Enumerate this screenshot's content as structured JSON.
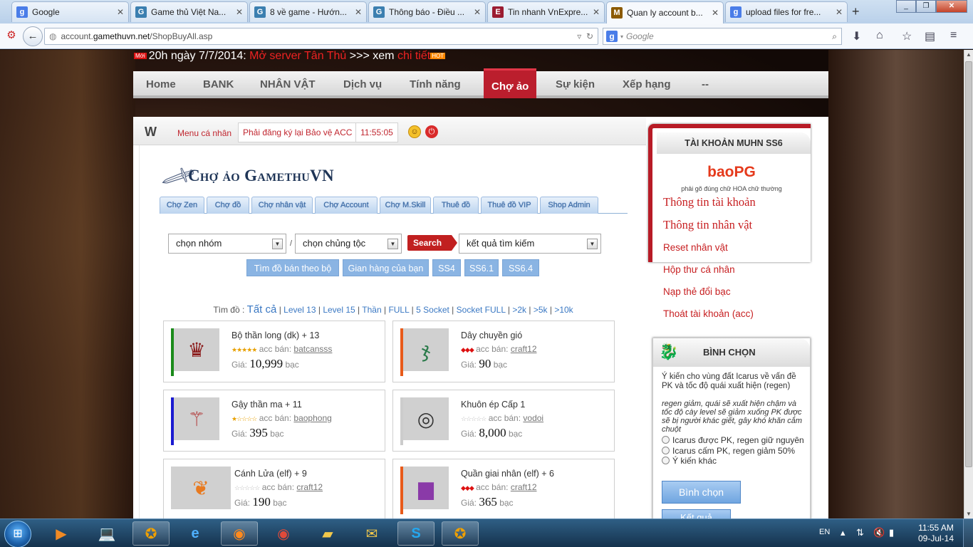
{
  "browser": {
    "tabs": [
      {
        "title": "Google",
        "icon": "G",
        "color": "#4a7de8"
      },
      {
        "title": "Game thủ Việt Na...",
        "icon": "G",
        "color": "#3b7fb0"
      },
      {
        "title": "8 về game - Hướn...",
        "icon": "8",
        "color": "#3b7fb0"
      },
      {
        "title": "Thông báo - Điều ...",
        "icon": "G",
        "color": "#3b7fb0"
      },
      {
        "title": "Tin nhanh VnExpre...",
        "icon": "E",
        "color": "#9b1c31"
      },
      {
        "title": "Quan ly account b...",
        "icon": "M",
        "color": "#8b5a00"
      },
      {
        "title": "upload files for fre...",
        "icon": "g",
        "color": "#4a7de8"
      }
    ],
    "url_prefix": "account.",
    "url_domain": "gamethuvn.net",
    "url_path": "/ShopBuyAll.asp",
    "search_placeholder": "Google"
  },
  "announcement": {
    "badge": "Mới",
    "time_text": "20h ngày 7/7/2014:",
    "server_text": "Mở server Tân Thủ",
    "see_text": ">>> xem",
    "detail_text": "chi tiết",
    "hot": "HOT"
  },
  "menu": [
    "Home",
    "BANK",
    "NHÂN VẬT",
    "Dịch vụ",
    "Tính năng",
    "Chợ ảo",
    "Sự kiện",
    "Xếp hạng",
    "--"
  ],
  "menu_active": "Chợ ảo",
  "topstrip": {
    "menu_label": "Menu cá nhân",
    "protect_label": "Phải đăng ký lại Bảo vệ ACC",
    "clock": "11:55:05"
  },
  "market": {
    "title": "Chợ ảo GamethuVN",
    "subtabs": [
      "Chợ Zen",
      "Chợ đồ",
      "Chợ nhân vật",
      "Chợ Account",
      "Chợ M.Skill",
      "Thuê đồ",
      "Thuê đồ VIP",
      "Shop Admin"
    ],
    "group_select": "chọn nhóm",
    "race_select": "chọn chủng tộc",
    "search_label": "Search",
    "result_select": "kết quả tìm kiếm",
    "filter_buttons": [
      "Tìm đồ bán theo bộ",
      "Gian hàng của bạn",
      "SS4",
      "SS6.1",
      "SS6.4"
    ],
    "find_label": "Tìm đồ :",
    "find_all": "Tất cả",
    "find_links": [
      "Level 13",
      "Level 15",
      "Thần",
      "FULL",
      "5 Socket",
      "Socket FULL",
      ">2k",
      ">5k",
      ">10k"
    ],
    "seller_label": "acc bán:",
    "price_label": "Giá:",
    "currency": "bạc",
    "items": [
      {
        "name": "Bộ thần long (dk) + 13",
        "seller": "batcansss",
        "price": "10,999",
        "stars": "★★★★★",
        "star_color": "#e8a000",
        "bar": "#1a8a1a",
        "icon": "♛",
        "icon_color": "#8b1a1a"
      },
      {
        "name": "Dây chuyền gió",
        "seller": "craft12",
        "price": "90",
        "stars": "◆◆◆",
        "star_color": "#d11",
        "bar": "#e85a1a",
        "icon": "ჯ",
        "icon_color": "#2a7a4a"
      },
      {
        "name": "Gậy thần ma + 11",
        "seller": "baophong",
        "price": "395",
        "stars": "★☆☆☆☆",
        "star_color": "#e8a000",
        "bar": "#1a1ad0",
        "icon": "⚚",
        "icon_color": "#b03030"
      },
      {
        "name": "Khuôn ép Cấp 1",
        "seller": "vodoi",
        "price": "8,000",
        "stars": "☆☆☆☆☆",
        "star_color": "#bbb",
        "bar": "#cccccc",
        "icon": "◎",
        "icon_color": "#333"
      },
      {
        "name": "Cánh Lửa (elf) + 9",
        "seller": "craft12",
        "price": "190",
        "stars": "☆☆☆☆☆",
        "star_color": "#bbb",
        "bar": "#cccccc",
        "icon": "❦",
        "icon_color": "#e87a20"
      },
      {
        "name": "Quần giai nhân (elf) + 6",
        "seller": "craft12",
        "price": "365",
        "stars": "◆◆◆",
        "star_color": "#d11",
        "bar": "#e85a1a",
        "icon": "▆",
        "icon_color": "#8a3aa8"
      }
    ]
  },
  "account": {
    "title": "TÀI KHOẢN MUHN SS6",
    "username": "baoPG",
    "note": "phải gõ đúng chữ HOA chữ thường",
    "links_big": [
      "Thông tin tài khoản",
      "Thông tin nhân vật"
    ],
    "links": [
      "Reset nhân vật",
      "Hộp thư cá nhân",
      "Nạp thẻ đổi bạc",
      "Thoát tài khoản (acc)"
    ]
  },
  "vote": {
    "title": "BÌNH CHỌN",
    "question": "Ý kiến cho vùng đất Icarus về vấn đề PK và tốc độ quái xuất hiện (regen)",
    "description": "regen giảm, quái sẽ xuất hiện chậm và tốc độ cày level sẽ giảm xuống PK được sẽ bị người khác giết, gây khó khăn cắm chuột",
    "options": [
      "Icarus được PK, regen giữ nguyên",
      "Icarus cấm PK, regen giảm 50%",
      "Ý kiến khác"
    ],
    "vote_button": "Bình chọn",
    "result_button": "Kết quả"
  },
  "taskbar": {
    "lang": "EN",
    "time": "11:55 AM",
    "date": "09-Jul-14"
  }
}
